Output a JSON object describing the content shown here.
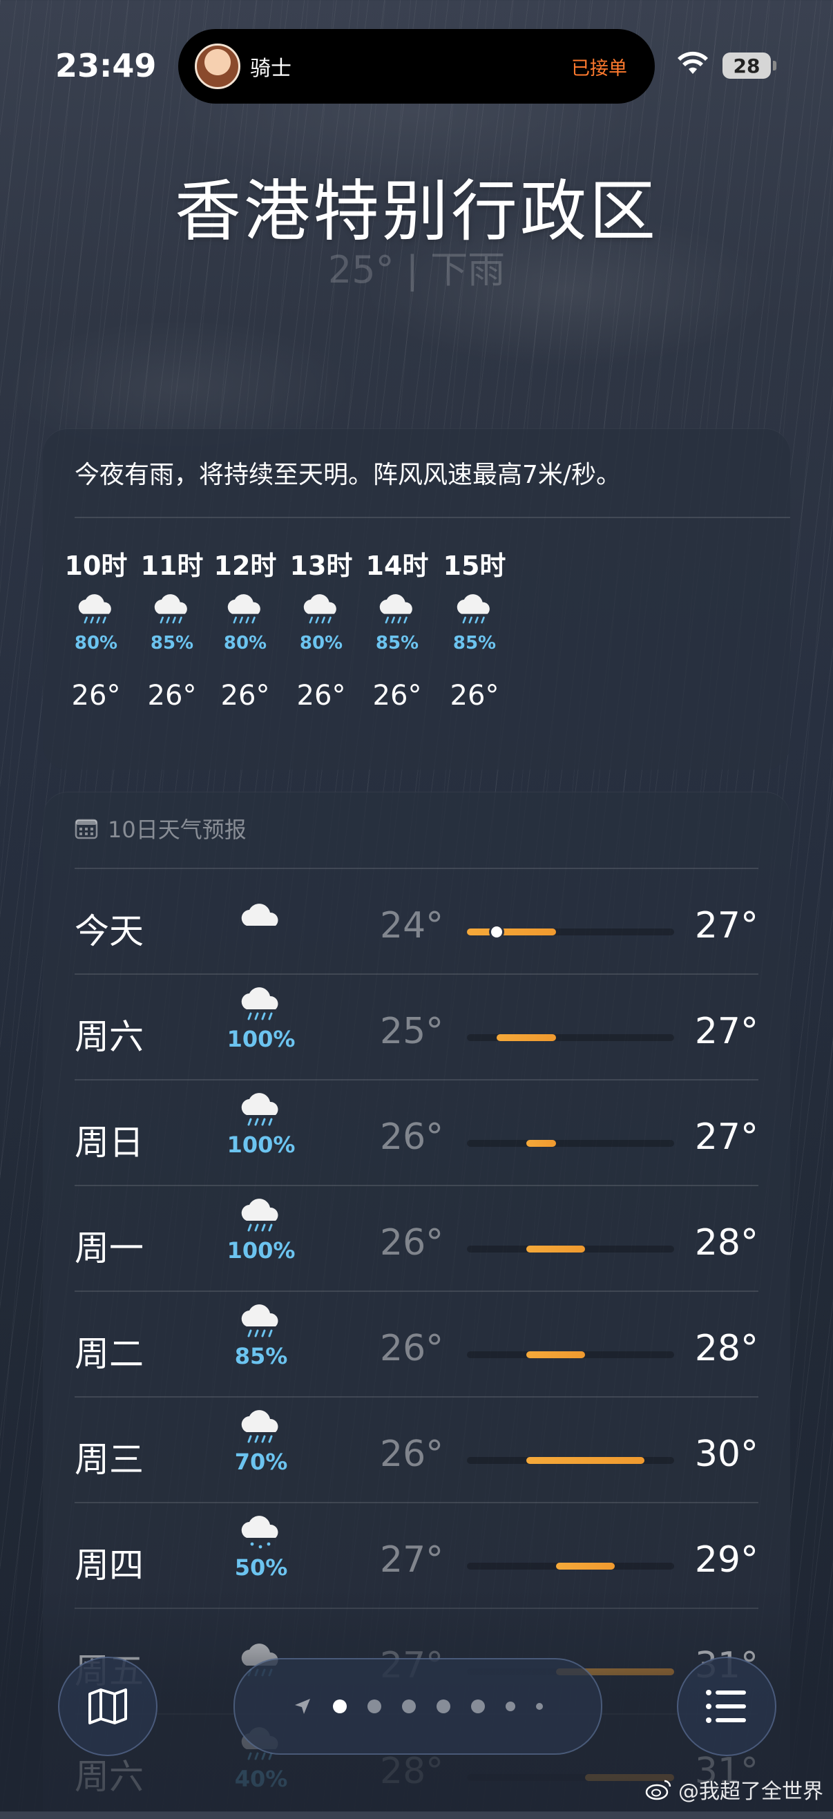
{
  "status_bar": {
    "time": "23:49",
    "activity_name": "骑士",
    "activity_status": "已接单",
    "battery": "28"
  },
  "location": {
    "city": "香港特别行政区",
    "condition": "25° | 下雨"
  },
  "hourly": {
    "summary": "今夜有雨，将持续至天明。阵风风速最高7米/秒。",
    "items": [
      {
        "time": "10时",
        "icon": "rain-cloud-icon",
        "precip": "80%",
        "temp": "26°"
      },
      {
        "time": "11时",
        "icon": "rain-cloud-icon",
        "precip": "85%",
        "temp": "26°"
      },
      {
        "time": "12时",
        "icon": "rain-cloud-icon",
        "precip": "80%",
        "temp": "26°"
      },
      {
        "time": "13时",
        "icon": "rain-cloud-icon",
        "precip": "80%",
        "temp": "26°"
      },
      {
        "time": "14时",
        "icon": "rain-cloud-icon",
        "precip": "85%",
        "temp": "26°"
      },
      {
        "time": "15时",
        "icon": "rain-cloud-icon",
        "precip": "85%",
        "temp": "26°"
      }
    ]
  },
  "daily": {
    "title": "10日天气预报",
    "range_min": 24,
    "range_max": 31,
    "current_temp": 25,
    "days": [
      {
        "day": "今天",
        "icon": "cloud-icon",
        "precip": "",
        "low": "24°",
        "high": "27°",
        "low_val": 24,
        "high_val": 27,
        "is_today": true
      },
      {
        "day": "周六",
        "icon": "rain-cloud-icon",
        "precip": "100%",
        "low": "25°",
        "high": "27°",
        "low_val": 25,
        "high_val": 27
      },
      {
        "day": "周日",
        "icon": "rain-cloud-icon",
        "precip": "100%",
        "low": "26°",
        "high": "27°",
        "low_val": 26,
        "high_val": 27
      },
      {
        "day": "周一",
        "icon": "rain-cloud-icon",
        "precip": "100%",
        "low": "26°",
        "high": "28°",
        "low_val": 26,
        "high_val": 28
      },
      {
        "day": "周二",
        "icon": "rain-cloud-icon",
        "precip": "85%",
        "low": "26°",
        "high": "28°",
        "low_val": 26,
        "high_val": 28
      },
      {
        "day": "周三",
        "icon": "rain-cloud-icon",
        "precip": "70%",
        "low": "26°",
        "high": "30°",
        "low_val": 26,
        "high_val": 30
      },
      {
        "day": "周四",
        "icon": "drizzle-cloud-icon",
        "precip": "50%",
        "low": "27°",
        "high": "29°",
        "low_val": 27,
        "high_val": 29
      },
      {
        "day": "周五",
        "icon": "rain-cloud-icon",
        "precip": "",
        "low": "27°",
        "high": "31°",
        "low_val": 27,
        "high_val": 31
      },
      {
        "day": "周六",
        "icon": "rain-cloud-icon",
        "precip": "40%",
        "low": "28°",
        "high": "31°",
        "low_val": 28,
        "high_val": 31
      }
    ]
  },
  "toolbar": {
    "map_icon": "map-icon",
    "list_icon": "list-icon",
    "page_count": 7,
    "active_page": 1
  },
  "watermark": "@我超了全世界",
  "colors": {
    "accent_orange": "#f5a93a",
    "precip_blue": "#6cc4f0",
    "activity_orange": "#ff7a2e"
  }
}
